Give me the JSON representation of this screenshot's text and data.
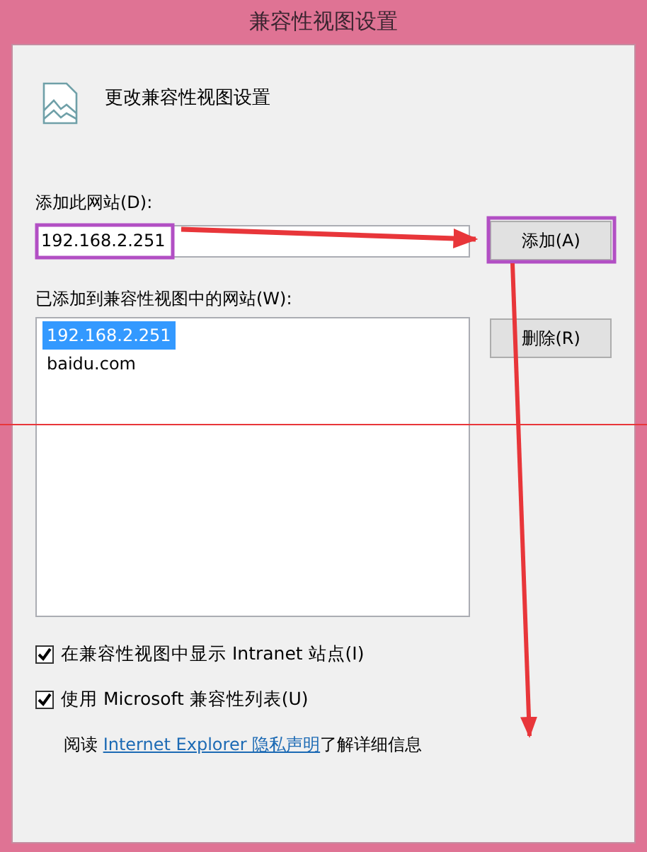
{
  "window": {
    "title": "兼容性视图设置"
  },
  "heading": "更改兼容性视图设置",
  "add_site": {
    "label": "添加此网站(D):",
    "value": "192.168.2.251",
    "button": "添加(A)"
  },
  "site_list": {
    "label": "已添加到兼容性视图中的网站(W):",
    "items": [
      {
        "text": "192.168.2.251",
        "selected": true
      },
      {
        "text": "baidu.com",
        "selected": false
      }
    ],
    "button": "删除(R)"
  },
  "options": [
    {
      "label": "在兼容性视图中显示 Intranet 站点(I)",
      "checked": true
    },
    {
      "label": "使用 Microsoft 兼容性列表(U)",
      "checked": true
    }
  ],
  "privacy": {
    "before": "阅读 ",
    "link": "Internet Explorer 隐私声明",
    "after": "了解详细信息"
  }
}
